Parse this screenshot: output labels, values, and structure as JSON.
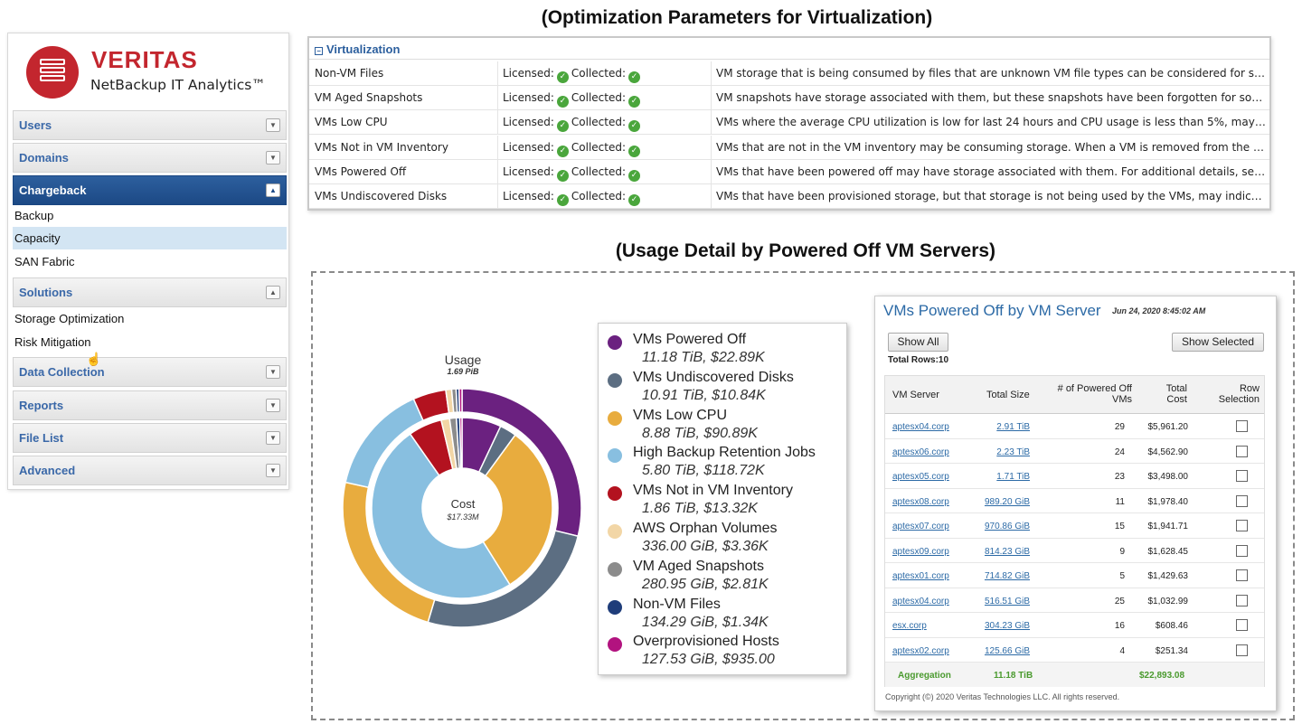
{
  "headings": {
    "optimization": "(Optimization Parameters for Virtualization)",
    "usage": "(Usage Detail by Powered Off VM Servers)"
  },
  "brand": {
    "name": "VERITAS",
    "product": "NetBackup IT Analytics™",
    "accent_color": "#c3262e"
  },
  "sidebar": {
    "items": [
      {
        "label": "Users",
        "type": "header",
        "toggle": "▼"
      },
      {
        "label": "Domains",
        "type": "header",
        "toggle": "▼"
      },
      {
        "label": "Chargeback",
        "type": "header",
        "active": true,
        "toggle": "▲"
      },
      {
        "label": "Backup",
        "type": "sub"
      },
      {
        "label": "Capacity",
        "type": "sub",
        "selected": true
      },
      {
        "label": "SAN Fabric",
        "type": "sub"
      },
      {
        "label": "Solutions",
        "type": "header",
        "toggle": "▲"
      },
      {
        "label": "Storage Optimization",
        "type": "sub",
        "hovered": true
      },
      {
        "label": "Risk Mitigation",
        "type": "sub"
      },
      {
        "label": "Data Collection",
        "type": "header",
        "toggle": "▼"
      },
      {
        "label": "Reports",
        "type": "header",
        "toggle": "▼"
      },
      {
        "label": "File List",
        "type": "header",
        "toggle": "▼"
      },
      {
        "label": "Advanced",
        "type": "header",
        "toggle": "▼"
      }
    ]
  },
  "virtualization": {
    "title": "Virtualization",
    "licensed_label": "Licensed:",
    "collected_label": "Collected:",
    "rows": [
      {
        "name": "Non-VM Files",
        "description": "VM storage that is being consumed by files that are unknown VM file types can be considered for storag..."
      },
      {
        "name": "VM Aged Snapshots",
        "description": "VM snapshots have storage associated with them, but these snapshots have been forgotten for some ti..."
      },
      {
        "name": "VMs Low CPU",
        "description": "VMs where the average CPU utilization is low for last 24 hours and CPU usage is less than 5%, may pro..."
      },
      {
        "name": "VMs Not in VM Inventory",
        "description": "VMs that are not in the VM inventory may be consuming storage. When a VM is removed from the inven..."
      },
      {
        "name": "VMs Powered Off",
        "description": "VMs that have been powered off may have storage associated with them. For additional details, see th..."
      },
      {
        "name": "VMs Undiscovered Disks",
        "description": "VMs that have been provisioned storage, but that storage is not being used by the VMs, may indicate a ..."
      }
    ]
  },
  "chart_data": {
    "type": "pie",
    "title": "",
    "outer_ring": {
      "label": "Usage",
      "total": "1.69 PiB"
    },
    "inner_ring": {
      "label": "Cost",
      "total": "$17.33M"
    },
    "series": [
      {
        "name": "VMs Powered Off",
        "size": "11.18 TiB",
        "cost": "$22.89K",
        "usage_share": 0.29,
        "cost_share": 0.07,
        "color": "#6b2180"
      },
      {
        "name": "VMs Undiscovered Disks",
        "size": "10.91 TiB",
        "cost": "$10.84K",
        "usage_share": 0.26,
        "cost_share": 0.03,
        "color": "#5c6e82"
      },
      {
        "name": "VMs Low CPU",
        "size": "8.88 TiB",
        "cost": "$90.89K",
        "usage_share": 0.24,
        "cost_share": 0.31,
        "color": "#e8ac3e"
      },
      {
        "name": "High Backup Retention Jobs",
        "size": "5.80 TiB",
        "cost": "$118.72K",
        "usage_share": 0.15,
        "cost_share": 0.49,
        "color": "#88bfe0"
      },
      {
        "name": "VMs Not in VM Inventory",
        "size": "1.86 TiB",
        "cost": "$13.32K",
        "usage_share": 0.045,
        "cost_share": 0.06,
        "color": "#b3121f"
      },
      {
        "name": "AWS Orphan Volumes",
        "size": "336.00 GiB",
        "cost": "$3.36K",
        "usage_share": 0.008,
        "cost_share": 0.015,
        "color": "#f2d6a6"
      },
      {
        "name": "VM Aged Snapshots",
        "size": "280.95 GiB",
        "cost": "$2.81K",
        "usage_share": 0.006,
        "cost_share": 0.012,
        "color": "#8c8c8c"
      },
      {
        "name": "Non-VM Files",
        "size": "134.29 GiB",
        "cost": "$1.34K",
        "usage_share": 0.004,
        "cost_share": 0.006,
        "color": "#1f3d7a"
      },
      {
        "name": "Overprovisioned Hosts",
        "size": "127.53 GiB",
        "cost": "$935.00",
        "usage_share": 0.004,
        "cost_share": 0.004,
        "color": "#b2137f"
      }
    ]
  },
  "vm_table": {
    "title": "VMs Powered Off by VM Server",
    "date": "Jun 24, 2020 8:45:02 AM",
    "show_all": "Show All",
    "show_selected": "Show Selected",
    "total_rows": "Total Rows:10",
    "columns": [
      "VM Server",
      "Total Size",
      "# of Powered Off VMs",
      "Total Cost",
      "Row Selection"
    ],
    "rows": [
      {
        "server": "aptesx04.corp",
        "size": "2.91 TiB",
        "count": "29",
        "cost": "$5,961.20"
      },
      {
        "server": "aptesx06.corp",
        "size": "2.23 TiB",
        "count": "24",
        "cost": "$4,562.90"
      },
      {
        "server": "aptesx05.corp",
        "size": "1.71 TiB",
        "count": "23",
        "cost": "$3,498.00"
      },
      {
        "server": "aptesx08.corp",
        "size": "989.20 GiB",
        "count": "11",
        "cost": "$1,978.40"
      },
      {
        "server": "aptesx07.corp",
        "size": "970.86 GiB",
        "count": "15",
        "cost": "$1,941.71"
      },
      {
        "server": "aptesx09.corp",
        "size": "814.23 GiB",
        "count": "9",
        "cost": "$1,628.45"
      },
      {
        "server": "aptesx01.corp",
        "size": "714.82 GiB",
        "count": "5",
        "cost": "$1,429.63"
      },
      {
        "server": "aptesx04.corp",
        "size": "516.51 GiB",
        "count": "25",
        "cost": "$1,032.99"
      },
      {
        "server": "esx.corp",
        "size": "304.23 GiB",
        "count": "16",
        "cost": "$608.46"
      },
      {
        "server": "aptesx02.corp",
        "size": "125.66 GiB",
        "count": "4",
        "cost": "$251.34"
      }
    ],
    "aggregation": {
      "label": "Aggregation",
      "size": "11.18 TiB",
      "cost": "$22,893.08"
    },
    "copyright": "Copyright (©) 2020 Veritas Technologies LLC. All rights reserved."
  }
}
